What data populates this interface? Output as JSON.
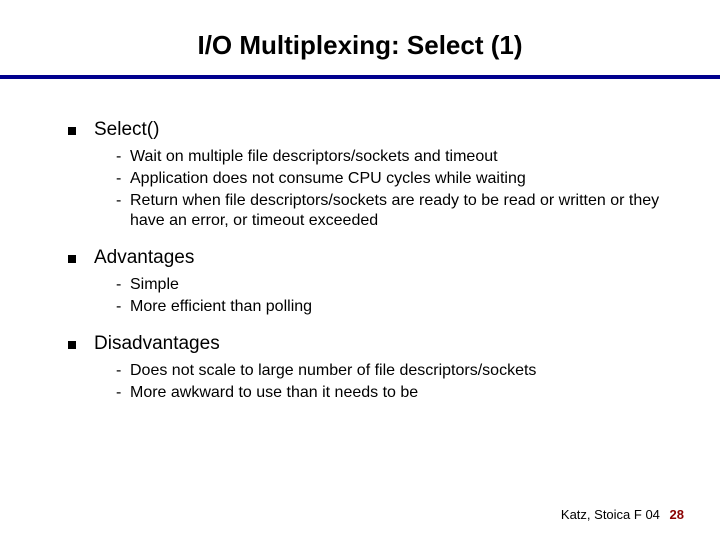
{
  "title": "I/O Multiplexing: Select (1)",
  "sections": [
    {
      "heading": "Select()",
      "items": [
        "Wait on multiple file descriptors/sockets and timeout",
        "Application does not consume CPU cycles while waiting",
        "Return when file descriptors/sockets are ready to be read or written or they have an error, or timeout exceeded"
      ]
    },
    {
      "heading": "Advantages",
      "items": [
        "Simple",
        "More efficient than polling"
      ]
    },
    {
      "heading": "Disadvantages",
      "items": [
        "Does not scale to large number of file descriptors/sockets",
        "More awkward to use than it needs to be"
      ]
    }
  ],
  "footer": {
    "text": "Katz, Stoica F 04",
    "page": "28"
  }
}
